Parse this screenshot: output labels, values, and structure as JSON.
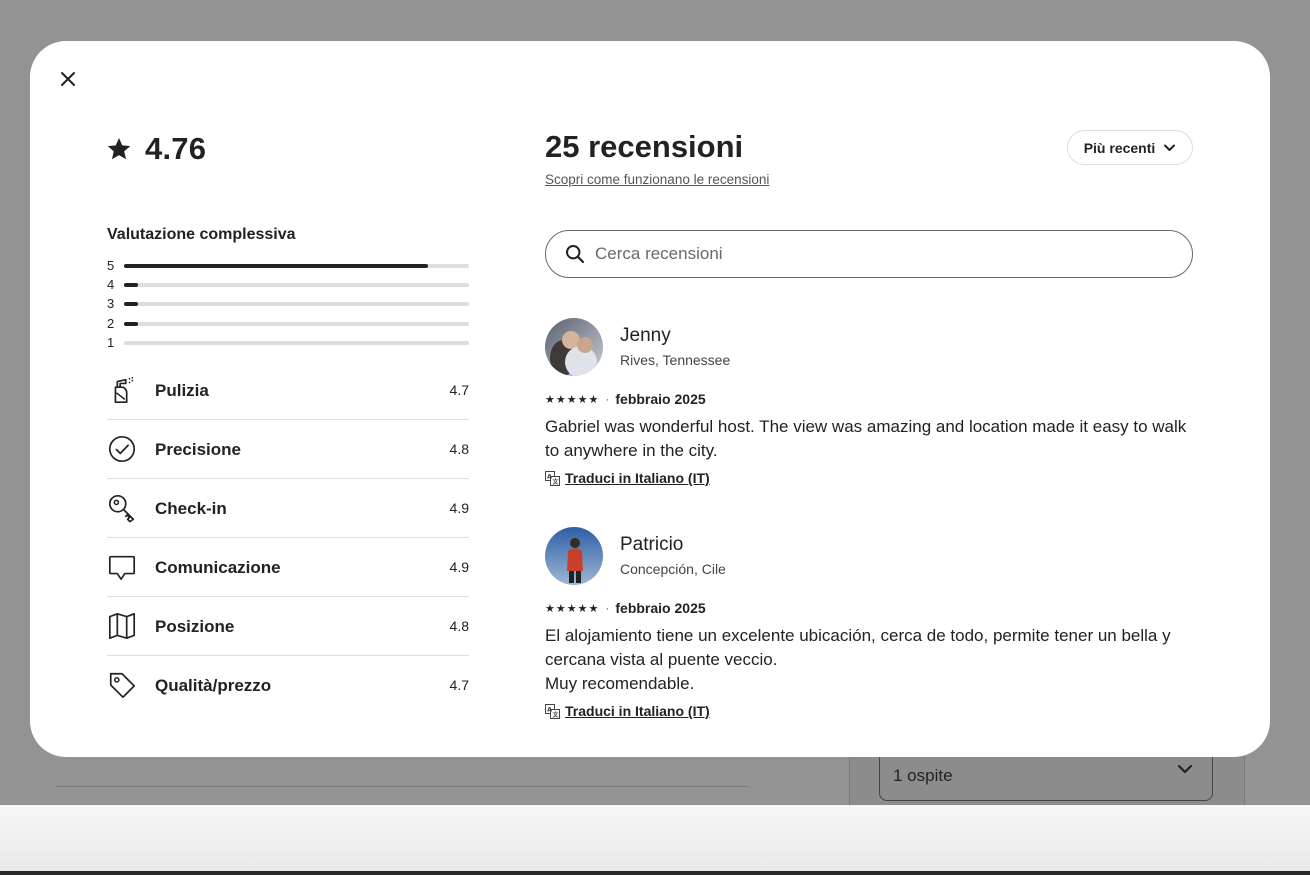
{
  "background": {
    "guest_select_value": "1 ospite"
  },
  "modal": {
    "overall_rating": "4.76",
    "overall_label": "Valutazione complessiva",
    "distribution": [
      {
        "stars": "5",
        "fraction": 0.88
      },
      {
        "stars": "4",
        "fraction": 0.04
      },
      {
        "stars": "3",
        "fraction": 0.04
      },
      {
        "stars": "2",
        "fraction": 0.04
      },
      {
        "stars": "1",
        "fraction": 0.0
      }
    ],
    "categories": [
      {
        "label": "Pulizia",
        "value": "4.7",
        "icon": "spray-bottle-icon"
      },
      {
        "label": "Precisione",
        "value": "4.8",
        "icon": "check-circle-icon"
      },
      {
        "label": "Check-in",
        "value": "4.9",
        "icon": "key-icon"
      },
      {
        "label": "Comunicazione",
        "value": "4.9",
        "icon": "chat-bubble-icon"
      },
      {
        "label": "Posizione",
        "value": "4.8",
        "icon": "map-icon"
      },
      {
        "label": "Qualità/prezzo",
        "value": "4.7",
        "icon": "price-tag-icon"
      }
    ],
    "reviews_count_title": "25 recensioni",
    "how_reviews_work_link": "Scopri come funzionano le recensioni",
    "sort_label": "Più recenti",
    "search_placeholder": "Cerca recensioni",
    "reviews": [
      {
        "name": "Jenny",
        "location": "Rives, Tennessee",
        "rating": 5,
        "date": "febbraio 2025",
        "text": "Gabriel was wonderful host. The view was amazing and location made it easy to walk to anywhere in the city.",
        "translate_label": "Traduci in Italiano (IT)"
      },
      {
        "name": "Patricio",
        "location": "Concepción, Cile",
        "rating": 5,
        "date": "febbraio 2025",
        "text": "El alojamiento tiene un excelente ubicación, cerca de todo, permite tener un bella y cercana vista al puente veccio.\nMuy recomendable.",
        "translate_label": "Traduci in Italiano (IT)"
      }
    ]
  },
  "colors": {
    "text": "#222222",
    "muted": "#6a6a6a",
    "divider": "#dddddd",
    "overlay": "#939393"
  }
}
